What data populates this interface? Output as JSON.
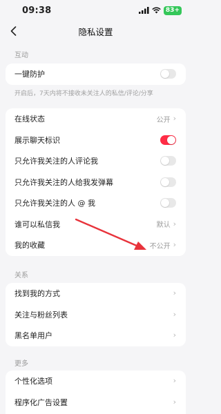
{
  "status_bar": {
    "time": "09:38",
    "battery": "83+"
  },
  "nav": {
    "title": "隐私设置"
  },
  "sections": {
    "interaction": {
      "label": "互动",
      "one_key_protect": "一键防护",
      "hint": "开启后，7天内将不接收未关注人的私信/评论/分享"
    },
    "privacy": {
      "online_status": "在线状态",
      "online_status_value": "公开",
      "chat_badge": "展示聊天标识",
      "only_followed_comment": "只允许我关注的人评论我",
      "only_followed_danmaku": "只允许我关注的人给我发弹幕",
      "only_followed_at": "只允许我关注的人 @ 我",
      "who_can_dm": "谁可以私信我",
      "who_can_dm_value": "默认",
      "my_favorites": "我的收藏",
      "my_favorites_value": "不公开"
    },
    "relations": {
      "label": "关系",
      "find_me": "找到我的方式",
      "follow_fans_list": "关注与粉丝列表",
      "blacklist": "黑名单用户"
    },
    "more": {
      "label": "更多",
      "personalization": "个性化选项",
      "programmatic_ads": "程序化广告设置"
    }
  },
  "toggles": {
    "one_key_protect": false,
    "chat_badge": true,
    "only_followed_comment": false,
    "only_followed_danmaku": false,
    "only_followed_at": false
  },
  "colors": {
    "accent": "#ff2d46",
    "arrow": "#e8333b",
    "battery": "#34c759"
  }
}
